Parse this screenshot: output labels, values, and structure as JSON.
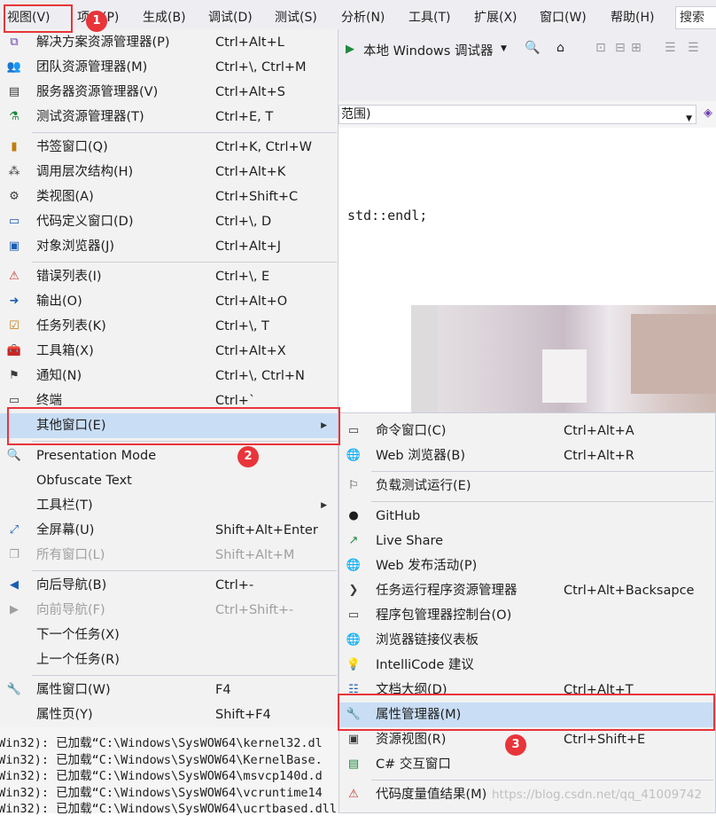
{
  "menubar": {
    "items": [
      "视图(V)",
      "项目(P)",
      "生成(B)",
      "调试(D)",
      "测试(S)",
      "分析(N)",
      "工具(T)",
      "扩展(X)",
      "窗口(W)",
      "帮助(H)"
    ],
    "search_label": "搜索"
  },
  "toolbar": {
    "debugger_label": "本地 Windows 调试器"
  },
  "scope_text": "范围)",
  "code_line": "std::endl;",
  "view_menu": {
    "groups": [
      [
        {
          "label": "解决方案资源管理器(P)",
          "shortcut": "Ctrl+Alt+L",
          "icon": "solution-explorer-icon"
        },
        {
          "label": "团队资源管理器(M)",
          "shortcut": "Ctrl+\\, Ctrl+M",
          "icon": "team-explorer-icon"
        },
        {
          "label": "服务器资源管理器(V)",
          "shortcut": "Ctrl+Alt+S",
          "icon": "server-explorer-icon"
        },
        {
          "label": "测试资源管理器(T)",
          "shortcut": "Ctrl+E, T",
          "icon": "test-explorer-icon"
        }
      ],
      [
        {
          "label": "书签窗口(Q)",
          "shortcut": "Ctrl+K, Ctrl+W",
          "icon": "bookmark-icon"
        },
        {
          "label": "调用层次结构(H)",
          "shortcut": "Ctrl+Alt+K",
          "icon": "call-hierarchy-icon"
        },
        {
          "label": "类视图(A)",
          "shortcut": "Ctrl+Shift+C",
          "icon": "class-view-icon"
        },
        {
          "label": "代码定义窗口(D)",
          "shortcut": "Ctrl+\\, D",
          "icon": "code-definition-icon"
        },
        {
          "label": "对象浏览器(J)",
          "shortcut": "Ctrl+Alt+J",
          "icon": "object-browser-icon"
        }
      ],
      [
        {
          "label": "错误列表(I)",
          "shortcut": "Ctrl+\\, E",
          "icon": "error-list-icon"
        },
        {
          "label": "输出(O)",
          "shortcut": "Ctrl+Alt+O",
          "icon": "output-icon"
        },
        {
          "label": "任务列表(K)",
          "shortcut": "Ctrl+\\, T",
          "icon": "task-list-icon"
        },
        {
          "label": "工具箱(X)",
          "shortcut": "Ctrl+Alt+X",
          "icon": "toolbox-icon"
        },
        {
          "label": "通知(N)",
          "shortcut": "Ctrl+\\, Ctrl+N",
          "icon": "notification-icon"
        },
        {
          "label": "终端",
          "shortcut": "Ctrl+`",
          "icon": "terminal-icon"
        },
        {
          "label": "其他窗口(E)",
          "shortcut": "",
          "icon": "",
          "submenu": true,
          "highlight": true
        }
      ],
      [
        {
          "label": "Presentation Mode",
          "shortcut": "",
          "icon": "magnifier-icon"
        },
        {
          "label": "Obfuscate Text",
          "shortcut": "",
          "icon": ""
        },
        {
          "label": "工具栏(T)",
          "shortcut": "",
          "icon": "",
          "submenu": true
        },
        {
          "label": "全屏幕(U)",
          "shortcut": "Shift+Alt+Enter",
          "icon": "fullscreen-icon"
        },
        {
          "label": "所有窗口(L)",
          "shortcut": "Shift+Alt+M",
          "icon": "all-windows-icon",
          "disabled": true
        }
      ],
      [
        {
          "label": "向后导航(B)",
          "shortcut": "Ctrl+-",
          "icon": "navigate-back-icon"
        },
        {
          "label": "向前导航(F)",
          "shortcut": "Ctrl+Shift+-",
          "icon": "navigate-forward-icon",
          "disabled": true
        },
        {
          "label": "下一个任务(X)",
          "shortcut": "",
          "icon": ""
        },
        {
          "label": "上一个任务(R)",
          "shortcut": "",
          "icon": ""
        }
      ],
      [
        {
          "label": "属性窗口(W)",
          "shortcut": "F4",
          "icon": "wrench-icon"
        },
        {
          "label": "属性页(Y)",
          "shortcut": "Shift+F4",
          "icon": ""
        }
      ]
    ]
  },
  "submenu": {
    "groups": [
      [
        {
          "label": "命令窗口(C)",
          "shortcut": "Ctrl+Alt+A",
          "icon": "command-window-icon"
        },
        {
          "label": "Web 浏览器(B)",
          "shortcut": "Ctrl+Alt+R",
          "icon": "web-browser-icon"
        }
      ],
      [
        {
          "label": "负载测试运行(E)",
          "shortcut": "",
          "icon": "load-test-icon"
        }
      ],
      [
        {
          "label": "GitHub",
          "shortcut": "",
          "icon": "github-icon"
        },
        {
          "label": "Live Share",
          "shortcut": "",
          "icon": "live-share-icon"
        },
        {
          "label": "Web 发布活动(P)",
          "shortcut": "",
          "icon": "web-publish-icon"
        },
        {
          "label": "任务运行程序资源管理器",
          "shortcut": "Ctrl+Alt+Backsapce",
          "icon": "task-runner-icon"
        },
        {
          "label": "程序包管理器控制台(O)",
          "shortcut": "",
          "icon": "package-console-icon"
        },
        {
          "label": "浏览器链接仪表板",
          "shortcut": "",
          "icon": "browser-link-icon"
        },
        {
          "label": "IntelliCode 建议",
          "shortcut": "",
          "icon": "intellicode-icon"
        },
        {
          "label": "文档大纲(D)",
          "shortcut": "Ctrl+Alt+T",
          "icon": "document-outline-icon"
        },
        {
          "label": "属性管理器(M)",
          "shortcut": "",
          "icon": "wrench-icon",
          "highlight": true
        },
        {
          "label": "资源视图(R)",
          "shortcut": "Ctrl+Shift+E",
          "icon": "resource-view-icon"
        },
        {
          "label": "C# 交互窗口",
          "shortcut": "",
          "icon": "csharp-interactive-icon"
        }
      ],
      [
        {
          "label": "代码度量值结果(M)",
          "shortcut": "",
          "icon": "code-metrics-icon"
        }
      ]
    ]
  },
  "output_lines": [
    "(Win32): 已加载“C:\\Windows\\SysWOW64\\kernel32.dl",
    "(Win32): 已加载“C:\\Windows\\SysWOW64\\KernelBase.",
    "(Win32): 已加载“C:\\Windows\\SysWOW64\\msvcp140d.d",
    "(Win32): 已加载“C:\\Windows\\SysWOW64\\vcruntime14",
    "(Win32): 已加载“C:\\Windows\\SysWOW64\\ucrtbased.dll"
  ],
  "annotations": [
    "1",
    "2",
    "3"
  ],
  "watermark": "https://blog.csdn.net/qq_41009742",
  "colors": {
    "highlight": "#c9def5",
    "annotation_red": "#e8353a",
    "menu_bg": "#f2f2f2"
  }
}
